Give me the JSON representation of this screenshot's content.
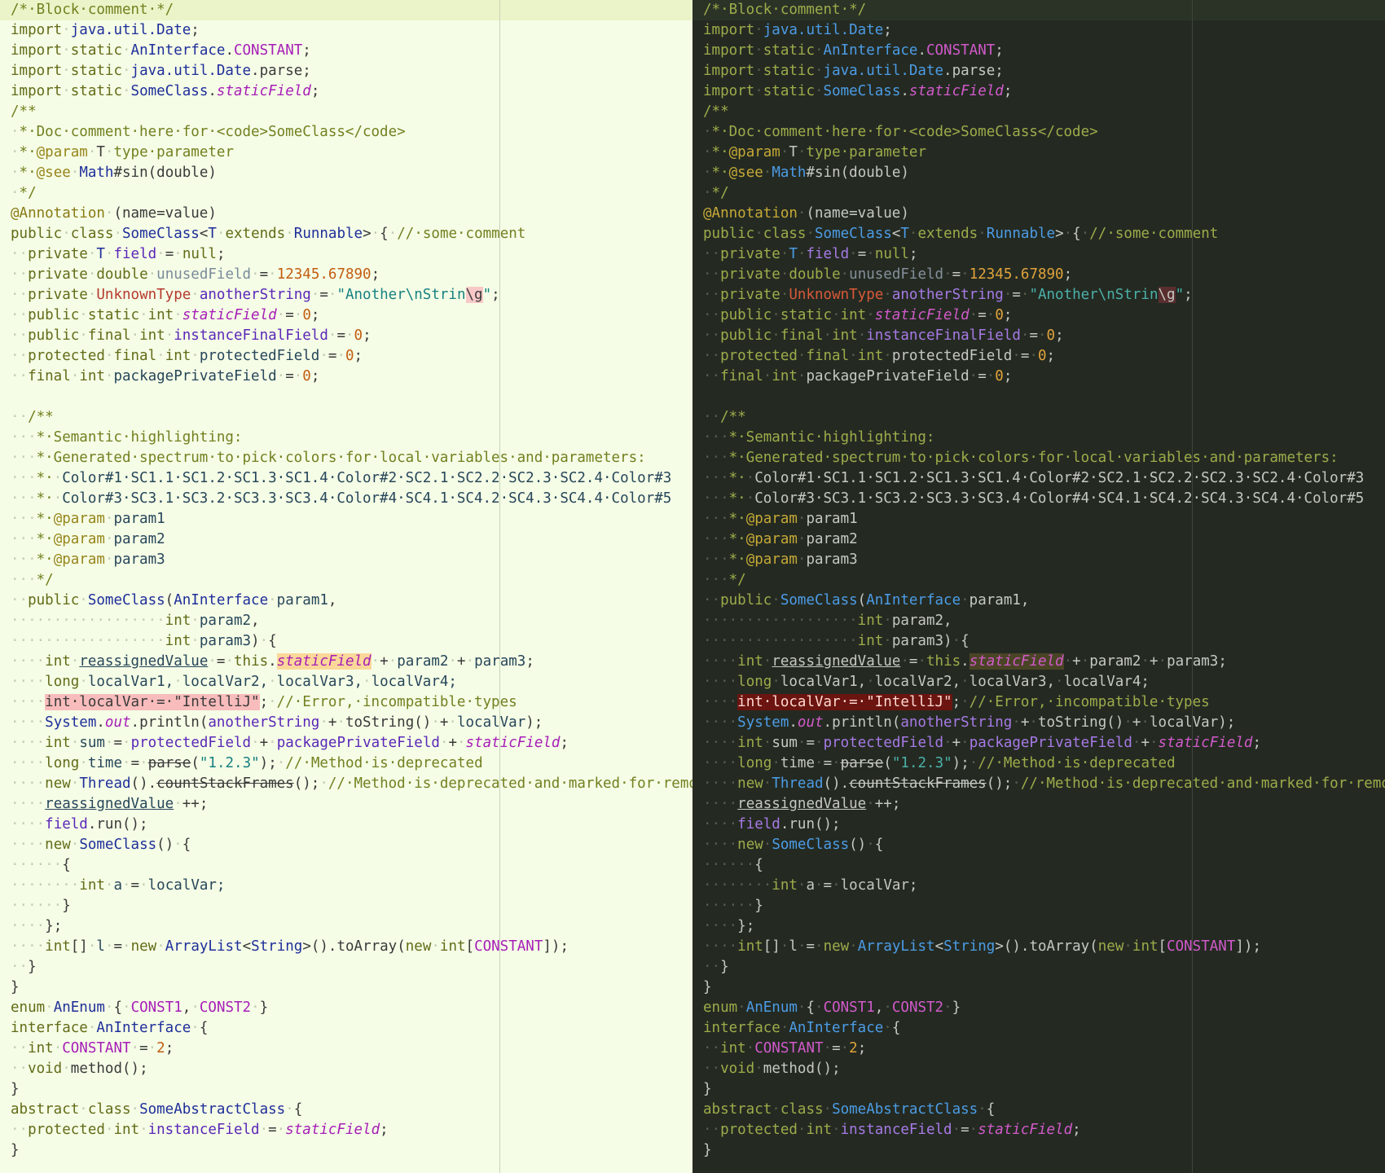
{
  "themes": {
    "light": {
      "background": "#f5fde6"
    },
    "dark": {
      "background": "#242a22"
    }
  },
  "code_lines": [
    [
      [
        "cm",
        "/*·Block·comment·*/"
      ]
    ],
    [
      [
        "kw",
        "import"
      ],
      [
        "ws",
        "·"
      ],
      [
        "ty",
        "java.util.Date"
      ],
      [
        "pl",
        ";"
      ]
    ],
    [
      [
        "kw",
        "import"
      ],
      [
        "ws",
        "·"
      ],
      [
        "kw",
        "static"
      ],
      [
        "ws",
        "·"
      ],
      [
        "ty",
        "AnInterface"
      ],
      [
        "pl",
        "."
      ],
      [
        "co",
        "CONSTANT"
      ],
      [
        "pl",
        ";"
      ]
    ],
    [
      [
        "kw",
        "import"
      ],
      [
        "ws",
        "·"
      ],
      [
        "kw",
        "static"
      ],
      [
        "ws",
        "·"
      ],
      [
        "ty",
        "java.util.Date"
      ],
      [
        "pl",
        ".parse;"
      ]
    ],
    [
      [
        "kw",
        "import"
      ],
      [
        "ws",
        "·"
      ],
      [
        "kw",
        "static"
      ],
      [
        "ws",
        "·"
      ],
      [
        "ty",
        "SomeClass"
      ],
      [
        "pl",
        "."
      ],
      [
        "sf",
        "staticField"
      ],
      [
        "pl",
        ";"
      ]
    ],
    [
      [
        "dc",
        "/**"
      ]
    ],
    [
      [
        "ws",
        "·"
      ],
      [
        "dc",
        "*·Doc·comment·here·for·<code>SomeClass</code>"
      ]
    ],
    [
      [
        "ws",
        "·"
      ],
      [
        "dc",
        "*·"
      ],
      [
        "dt",
        "@param"
      ],
      [
        "ws",
        "·"
      ],
      [
        "pl",
        "T"
      ],
      [
        "ws",
        "·"
      ],
      [
        "dc",
        "type·parameter"
      ]
    ],
    [
      [
        "ws",
        "·"
      ],
      [
        "dc",
        "*·"
      ],
      [
        "dt",
        "@see"
      ],
      [
        "ws",
        "·"
      ],
      [
        "ty",
        "Math"
      ],
      [
        "pl",
        "#sin(double)"
      ]
    ],
    [
      [
        "ws",
        "·"
      ],
      [
        "dc",
        "*/"
      ]
    ],
    [
      [
        "ann",
        "@Annotation"
      ],
      [
        "ws",
        "·"
      ],
      [
        "pl",
        "(name=value)"
      ]
    ],
    [
      [
        "kw",
        "public"
      ],
      [
        "ws",
        "·"
      ],
      [
        "kw",
        "class"
      ],
      [
        "ws",
        "·"
      ],
      [
        "ty",
        "SomeClass"
      ],
      [
        "pl",
        "<"
      ],
      [
        "ty",
        "T"
      ],
      [
        "ws",
        "·"
      ],
      [
        "kw",
        "extends"
      ],
      [
        "ws",
        "·"
      ],
      [
        "ty",
        "Runnable"
      ],
      [
        "pl",
        ">"
      ],
      [
        "ws",
        "·"
      ],
      [
        "pl",
        "{"
      ],
      [
        "ws",
        "·"
      ],
      [
        "cm",
        "//·some·comment"
      ]
    ],
    [
      [
        "ws",
        "··"
      ],
      [
        "kw",
        "private"
      ],
      [
        "ws",
        "·"
      ],
      [
        "ty",
        "T"
      ],
      [
        "ws",
        "·"
      ],
      [
        "fld",
        "field"
      ],
      [
        "ws",
        "·"
      ],
      [
        "pl",
        "="
      ],
      [
        "ws",
        "·"
      ],
      [
        "kw",
        "null"
      ],
      [
        "pl",
        ";"
      ]
    ],
    [
      [
        "ws",
        "··"
      ],
      [
        "kw",
        "private"
      ],
      [
        "ws",
        "·"
      ],
      [
        "kw",
        "double"
      ],
      [
        "ws",
        "·"
      ],
      [
        "uf",
        "unusedField"
      ],
      [
        "ws",
        "·"
      ],
      [
        "pl",
        "="
      ],
      [
        "ws",
        "·"
      ],
      [
        "num",
        "12345.67890"
      ],
      [
        "pl",
        ";"
      ]
    ],
    [
      [
        "ws",
        "··"
      ],
      [
        "kw",
        "private"
      ],
      [
        "ws",
        "·"
      ],
      [
        "unk",
        "UnknownType"
      ],
      [
        "ws",
        "·"
      ],
      [
        "fld",
        "anotherString"
      ],
      [
        "ws",
        "·"
      ],
      [
        "pl",
        "="
      ],
      [
        "ws",
        "·"
      ],
      [
        "str",
        "\"Another\\nStrin"
      ],
      [
        "esc",
        "\\g"
      ],
      [
        "str",
        "\""
      ],
      [
        "pl",
        ";"
      ]
    ],
    [
      [
        "ws",
        "··"
      ],
      [
        "kw",
        "public"
      ],
      [
        "ws",
        "·"
      ],
      [
        "kw",
        "static"
      ],
      [
        "ws",
        "·"
      ],
      [
        "kw",
        "int"
      ],
      [
        "ws",
        "·"
      ],
      [
        "sf",
        "staticField"
      ],
      [
        "ws",
        "·"
      ],
      [
        "pl",
        "="
      ],
      [
        "ws",
        "·"
      ],
      [
        "num",
        "0"
      ],
      [
        "pl",
        ";"
      ]
    ],
    [
      [
        "ws",
        "··"
      ],
      [
        "kw",
        "public"
      ],
      [
        "ws",
        "·"
      ],
      [
        "kw",
        "final"
      ],
      [
        "ws",
        "·"
      ],
      [
        "kw",
        "int"
      ],
      [
        "ws",
        "·"
      ],
      [
        "fld",
        "instanceFinalField"
      ],
      [
        "ws",
        "·"
      ],
      [
        "pl",
        "="
      ],
      [
        "ws",
        "·"
      ],
      [
        "num",
        "0"
      ],
      [
        "pl",
        ";"
      ]
    ],
    [
      [
        "ws",
        "··"
      ],
      [
        "kw",
        "protected"
      ],
      [
        "ws",
        "·"
      ],
      [
        "kw",
        "final"
      ],
      [
        "ws",
        "·"
      ],
      [
        "kw",
        "int"
      ],
      [
        "ws",
        "·"
      ],
      [
        "lv",
        "protectedField"
      ],
      [
        "ws",
        "·"
      ],
      [
        "pl",
        "="
      ],
      [
        "ws",
        "·"
      ],
      [
        "num",
        "0"
      ],
      [
        "pl",
        ";"
      ]
    ],
    [
      [
        "ws",
        "··"
      ],
      [
        "kw",
        "final"
      ],
      [
        "ws",
        "·"
      ],
      [
        "kw",
        "int"
      ],
      [
        "ws",
        "·"
      ],
      [
        "lv",
        "packagePrivateField"
      ],
      [
        "ws",
        "·"
      ],
      [
        "pl",
        "="
      ],
      [
        "ws",
        "·"
      ],
      [
        "num",
        "0"
      ],
      [
        "pl",
        ";"
      ]
    ],
    [],
    [
      [
        "ws",
        "··"
      ],
      [
        "dc",
        "/**"
      ]
    ],
    [
      [
        "ws",
        "···"
      ],
      [
        "dc",
        "*·Semantic·highlighting:"
      ]
    ],
    [
      [
        "ws",
        "···"
      ],
      [
        "dc",
        "*·Generated·spectrum·to·pick·colors·for·local·variables·and·parameters:"
      ]
    ],
    [
      [
        "ws",
        "···"
      ],
      [
        "dc",
        "*·"
      ],
      [
        "ws",
        "·"
      ],
      [
        "pm",
        "Color#1·SC1.1·SC1.2·SC1.3·SC1.4·Color#2·SC2.1·SC2.2·SC2.3·SC2.4·Color#3"
      ]
    ],
    [
      [
        "ws",
        "···"
      ],
      [
        "dc",
        "*·"
      ],
      [
        "ws",
        "·"
      ],
      [
        "pm",
        "Color#3·SC3.1·SC3.2·SC3.3·SC3.4·Color#4·SC4.1·SC4.2·SC4.3·SC4.4·Color#5"
      ]
    ],
    [
      [
        "ws",
        "···"
      ],
      [
        "dc",
        "*·"
      ],
      [
        "dt",
        "@param"
      ],
      [
        "ws",
        "·"
      ],
      [
        "pm",
        "param1"
      ]
    ],
    [
      [
        "ws",
        "···"
      ],
      [
        "dc",
        "*·"
      ],
      [
        "dt",
        "@param"
      ],
      [
        "ws",
        "·"
      ],
      [
        "pm",
        "param2"
      ]
    ],
    [
      [
        "ws",
        "···"
      ],
      [
        "dc",
        "*·"
      ],
      [
        "dt",
        "@param"
      ],
      [
        "ws",
        "·"
      ],
      [
        "pm",
        "param3"
      ]
    ],
    [
      [
        "ws",
        "···"
      ],
      [
        "dc",
        "*/"
      ]
    ],
    [
      [
        "ws",
        "··"
      ],
      [
        "kw",
        "public"
      ],
      [
        "ws",
        "·"
      ],
      [
        "ty",
        "SomeClass"
      ],
      [
        "pl",
        "("
      ],
      [
        "ty",
        "AnInterface"
      ],
      [
        "ws",
        "·"
      ],
      [
        "pm",
        "param1"
      ],
      [
        "pl",
        ","
      ]
    ],
    [
      [
        "ws",
        "··················"
      ],
      [
        "kw",
        "int"
      ],
      [
        "ws",
        "·"
      ],
      [
        "pm",
        "param2"
      ],
      [
        "pl",
        ","
      ]
    ],
    [
      [
        "ws",
        "··················"
      ],
      [
        "kw",
        "int"
      ],
      [
        "ws",
        "·"
      ],
      [
        "pm",
        "param3"
      ],
      [
        "pl",
        ")"
      ],
      [
        "ws",
        "·"
      ],
      [
        "pl",
        "{"
      ]
    ],
    [
      [
        "ws",
        "····"
      ],
      [
        "kw",
        "int"
      ],
      [
        "ws",
        "·"
      ],
      [
        "lv ul",
        "reassignedValue"
      ],
      [
        "ws",
        "·"
      ],
      [
        "pl",
        "="
      ],
      [
        "ws",
        "·"
      ],
      [
        "kw",
        "this"
      ],
      [
        "pl",
        "."
      ],
      [
        "sf hl",
        "staticField"
      ],
      [
        "ws",
        "·"
      ],
      [
        "pl",
        "+"
      ],
      [
        "ws",
        "·"
      ],
      [
        "pm",
        "param2"
      ],
      [
        "ws",
        "·"
      ],
      [
        "pl",
        "+"
      ],
      [
        "ws",
        "·"
      ],
      [
        "pm",
        "param3"
      ],
      [
        "pl",
        ";"
      ]
    ],
    [
      [
        "ws",
        "····"
      ],
      [
        "kw",
        "long"
      ],
      [
        "ws",
        "·"
      ],
      [
        "lv",
        "localVar1,"
      ],
      [
        "ws",
        "·"
      ],
      [
        "lv",
        "localVar2,"
      ],
      [
        "ws",
        "·"
      ],
      [
        "lv",
        "localVar3,"
      ],
      [
        "ws",
        "·"
      ],
      [
        "lv",
        "localVar4;"
      ]
    ],
    [
      [
        "ws",
        "····"
      ],
      [
        "err",
        "int·localVar·=·\"IntelliJ\""
      ],
      [
        "pl",
        ";"
      ],
      [
        "ws",
        "·"
      ],
      [
        "cm",
        "//·Error,·incompatible·types"
      ]
    ],
    [
      [
        "ws",
        "····"
      ],
      [
        "ty",
        "System"
      ],
      [
        "pl",
        "."
      ],
      [
        "sf",
        "out"
      ],
      [
        "pl",
        ".println("
      ],
      [
        "fld",
        "anotherString"
      ],
      [
        "ws",
        "·"
      ],
      [
        "pl",
        "+"
      ],
      [
        "ws",
        "·"
      ],
      [
        "pl",
        "toString()"
      ],
      [
        "ws",
        "·"
      ],
      [
        "pl",
        "+"
      ],
      [
        "ws",
        "·"
      ],
      [
        "lv",
        "localVar"
      ],
      [
        "pl",
        ");"
      ]
    ],
    [
      [
        "ws",
        "····"
      ],
      [
        "kw",
        "int"
      ],
      [
        "ws",
        "·"
      ],
      [
        "lv",
        "sum"
      ],
      [
        "ws",
        "·"
      ],
      [
        "pl",
        "="
      ],
      [
        "ws",
        "·"
      ],
      [
        "fld",
        "protectedField"
      ],
      [
        "ws",
        "·"
      ],
      [
        "pl",
        "+"
      ],
      [
        "ws",
        "·"
      ],
      [
        "fld",
        "packagePrivateField"
      ],
      [
        "ws",
        "·"
      ],
      [
        "pl",
        "+"
      ],
      [
        "ws",
        "·"
      ],
      [
        "sf",
        "staticField"
      ],
      [
        "pl",
        ";"
      ]
    ],
    [
      [
        "ws",
        "····"
      ],
      [
        "kw",
        "long"
      ],
      [
        "ws",
        "·"
      ],
      [
        "lv",
        "time"
      ],
      [
        "ws",
        "·"
      ],
      [
        "pl",
        "="
      ],
      [
        "ws",
        "·"
      ],
      [
        "pl strike",
        "parse"
      ],
      [
        "pl",
        "("
      ],
      [
        "str",
        "\"1.2.3\""
      ],
      [
        "pl",
        ");"
      ],
      [
        "ws",
        "·"
      ],
      [
        "cm",
        "//·Method·is·deprecated"
      ]
    ],
    [
      [
        "ws",
        "····"
      ],
      [
        "kw",
        "new"
      ],
      [
        "ws",
        "·"
      ],
      [
        "ty",
        "Thread"
      ],
      [
        "pl",
        "()."
      ],
      [
        "pl strike",
        "countStackFrames"
      ],
      [
        "pl",
        "();"
      ],
      [
        "ws",
        "·"
      ],
      [
        "cm",
        "//·Method·is·deprecated·and·marked·for·removal"
      ]
    ],
    [
      [
        "ws",
        "····"
      ],
      [
        "lv ul",
        "reassignedValue"
      ],
      [
        "ws",
        "·"
      ],
      [
        "pl",
        "++;"
      ]
    ],
    [
      [
        "ws",
        "····"
      ],
      [
        "fld",
        "field"
      ],
      [
        "pl",
        ".run();"
      ]
    ],
    [
      [
        "ws",
        "····"
      ],
      [
        "kw",
        "new"
      ],
      [
        "ws",
        "·"
      ],
      [
        "ty",
        "SomeClass"
      ],
      [
        "pl",
        "()"
      ],
      [
        "ws",
        "·"
      ],
      [
        "pl",
        "{"
      ]
    ],
    [
      [
        "ws",
        "······"
      ],
      [
        "pl",
        "{"
      ]
    ],
    [
      [
        "ws",
        "········"
      ],
      [
        "kw",
        "int"
      ],
      [
        "ws",
        "·"
      ],
      [
        "lv",
        "a"
      ],
      [
        "ws",
        "·"
      ],
      [
        "pl",
        "="
      ],
      [
        "ws",
        "·"
      ],
      [
        "lv",
        "localVar;"
      ]
    ],
    [
      [
        "ws",
        "······"
      ],
      [
        "pl",
        "}"
      ]
    ],
    [
      [
        "ws",
        "····"
      ],
      [
        "pl",
        "};"
      ]
    ],
    [
      [
        "ws",
        "····"
      ],
      [
        "kw",
        "int"
      ],
      [
        "pl",
        "[]"
      ],
      [
        "ws",
        "·"
      ],
      [
        "lv",
        "l"
      ],
      [
        "ws",
        "·"
      ],
      [
        "pl",
        "="
      ],
      [
        "ws",
        "·"
      ],
      [
        "kw",
        "new"
      ],
      [
        "ws",
        "·"
      ],
      [
        "ty",
        "ArrayList"
      ],
      [
        "pl",
        "<"
      ],
      [
        "ty",
        "String"
      ],
      [
        "pl",
        ">().toArray("
      ],
      [
        "kw",
        "new"
      ],
      [
        "ws",
        "·"
      ],
      [
        "kw",
        "int"
      ],
      [
        "pl",
        "["
      ],
      [
        "co",
        "CONSTANT"
      ],
      [
        "pl",
        "]);"
      ]
    ],
    [
      [
        "ws",
        "··"
      ],
      [
        "pl",
        "}"
      ]
    ],
    [
      [
        "pl",
        "}"
      ]
    ],
    [
      [
        "kw",
        "enum"
      ],
      [
        "ws",
        "·"
      ],
      [
        "ty",
        "AnEnum"
      ],
      [
        "ws",
        "·"
      ],
      [
        "pl",
        "{"
      ],
      [
        "ws",
        "·"
      ],
      [
        "co",
        "CONST1"
      ],
      [
        "pl",
        ","
      ],
      [
        "ws",
        "·"
      ],
      [
        "co",
        "CONST2"
      ],
      [
        "ws",
        "·"
      ],
      [
        "pl",
        "}"
      ]
    ],
    [
      [
        "kw",
        "interface"
      ],
      [
        "ws",
        "·"
      ],
      [
        "ty",
        "AnInterface"
      ],
      [
        "ws",
        "·"
      ],
      [
        "pl",
        "{"
      ]
    ],
    [
      [
        "ws",
        "··"
      ],
      [
        "kw",
        "int"
      ],
      [
        "ws",
        "·"
      ],
      [
        "co",
        "CONSTANT"
      ],
      [
        "ws",
        "·"
      ],
      [
        "pl",
        "="
      ],
      [
        "ws",
        "·"
      ],
      [
        "num",
        "2"
      ],
      [
        "pl",
        ";"
      ]
    ],
    [
      [
        "ws",
        "··"
      ],
      [
        "kw",
        "void"
      ],
      [
        "ws",
        "·"
      ],
      [
        "pl",
        "method();"
      ]
    ],
    [
      [
        "pl",
        "}"
      ]
    ],
    [
      [
        "kw",
        "abstract"
      ],
      [
        "ws",
        "·"
      ],
      [
        "kw",
        "class"
      ],
      [
        "ws",
        "·"
      ],
      [
        "ty",
        "SomeAbstractClass"
      ],
      [
        "ws",
        "·"
      ],
      [
        "pl",
        "{"
      ]
    ],
    [
      [
        "ws",
        "··"
      ],
      [
        "kw",
        "protected"
      ],
      [
        "ws",
        "·"
      ],
      [
        "kw",
        "int"
      ],
      [
        "ws",
        "·"
      ],
      [
        "fld",
        "instanceField"
      ],
      [
        "ws",
        "·"
      ],
      [
        "pl",
        "="
      ],
      [
        "ws",
        "·"
      ],
      [
        "sf",
        "staticField"
      ],
      [
        "pl",
        ";"
      ]
    ],
    [
      [
        "pl",
        "}"
      ]
    ]
  ]
}
